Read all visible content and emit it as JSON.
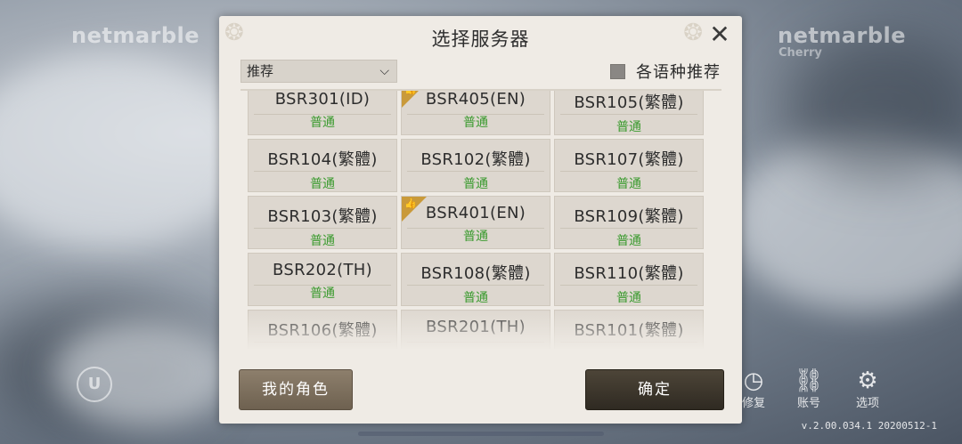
{
  "background": {
    "left_logo": "netmarble",
    "right_logo": "netmarble",
    "right_logo_sub": "Cherry",
    "bottom_icons": [
      {
        "icon": "clock-icon",
        "label": "修复"
      },
      {
        "icon": "link-icon",
        "label": "账号"
      },
      {
        "icon": "gear-icon",
        "label": "选项"
      }
    ],
    "version": "v.2.00.034.1  20200512-1"
  },
  "dialog": {
    "title": "选择服务器",
    "filter_value": "推荐",
    "lang_recommend_label": "各语种推荐",
    "servers": [
      {
        "name": "BSR301(ID)",
        "status": "普通",
        "recommended": false
      },
      {
        "name": "BSR405(EN)",
        "status": "普通",
        "recommended": true
      },
      {
        "name": "BSR105(繁體)",
        "status": "普通",
        "recommended": false
      },
      {
        "name": "BSR104(繁體)",
        "status": "普通",
        "recommended": false
      },
      {
        "name": "BSR102(繁體)",
        "status": "普通",
        "recommended": false
      },
      {
        "name": "BSR107(繁體)",
        "status": "普通",
        "recommended": false
      },
      {
        "name": "BSR103(繁體)",
        "status": "普通",
        "recommended": false
      },
      {
        "name": "BSR401(EN)",
        "status": "普通",
        "recommended": true
      },
      {
        "name": "BSR109(繁體)",
        "status": "普通",
        "recommended": false
      },
      {
        "name": "BSR202(TH)",
        "status": "普通",
        "recommended": false
      },
      {
        "name": "BSR108(繁體)",
        "status": "普通",
        "recommended": false
      },
      {
        "name": "BSR110(繁體)",
        "status": "普通",
        "recommended": false
      },
      {
        "name": "BSR106(繁體)",
        "status": "",
        "recommended": false
      },
      {
        "name": "BSR201(TH)",
        "status": "",
        "recommended": false
      },
      {
        "name": "BSR101(繁體)",
        "status": "",
        "recommended": false
      }
    ],
    "my_roles_label": "我的角色",
    "confirm_label": "确定"
  },
  "colors": {
    "status_normal": "#3a9a2e",
    "badge": "#c99a3a",
    "confirm_button": "#2f2a22"
  }
}
